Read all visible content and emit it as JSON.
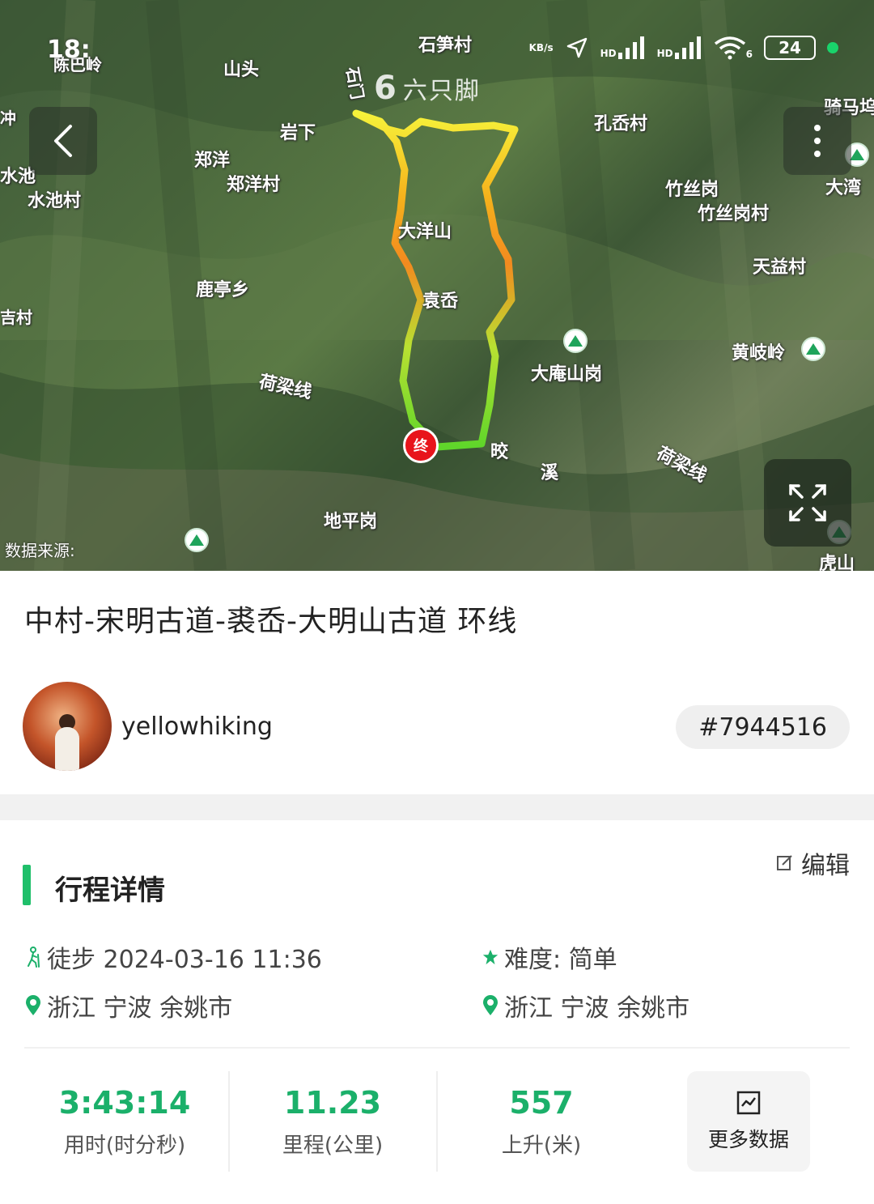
{
  "status_bar": {
    "time": "18:",
    "speed_unit": "KB/s",
    "hd1": "HD",
    "hd2": "HD",
    "wifi_badge": "6",
    "battery": "24"
  },
  "map": {
    "watermark": "六只脚",
    "data_source": "数据来源:",
    "end_marker": "终",
    "labels": [
      "石笋村",
      "山头",
      "郑洋",
      "郑洋村",
      "岩下",
      "水池",
      "水池村",
      "孔岙村",
      "骑马坞",
      "竹丝岗",
      "竹丝岗村",
      "天益村",
      "大洋山",
      "袁岙",
      "鹿亭乡",
      "黄岐岭",
      "大庵山岗",
      "荷梁线",
      "荷梁线",
      "地平岗",
      "虎山",
      "大湾",
      "晈",
      "溪",
      "吉村",
      "陈巴岭",
      "石门",
      "冲"
    ]
  },
  "route": {
    "title": "中村-宋明古道-裘岙-大明山古道 环线",
    "username": "yellowhiking",
    "id": "#7944516"
  },
  "details": {
    "section_title": "行程详情",
    "edit_label": "编辑",
    "activity": "徒步 2024-03-16 11:36",
    "difficulty": "难度: 简单",
    "start_location": "浙江 宁波 余姚市",
    "end_location": "浙江 宁波 余姚市"
  },
  "stats": {
    "duration_value": "3:43:14",
    "duration_label": "用时(时分秒)",
    "distance_value": "11.23",
    "distance_label": "里程(公里)",
    "ascent_value": "557",
    "ascent_label": "上升(米)",
    "more_label": "更多数据"
  },
  "colors": {
    "accent": "#1bb06a",
    "end_marker": "#e8141b"
  }
}
